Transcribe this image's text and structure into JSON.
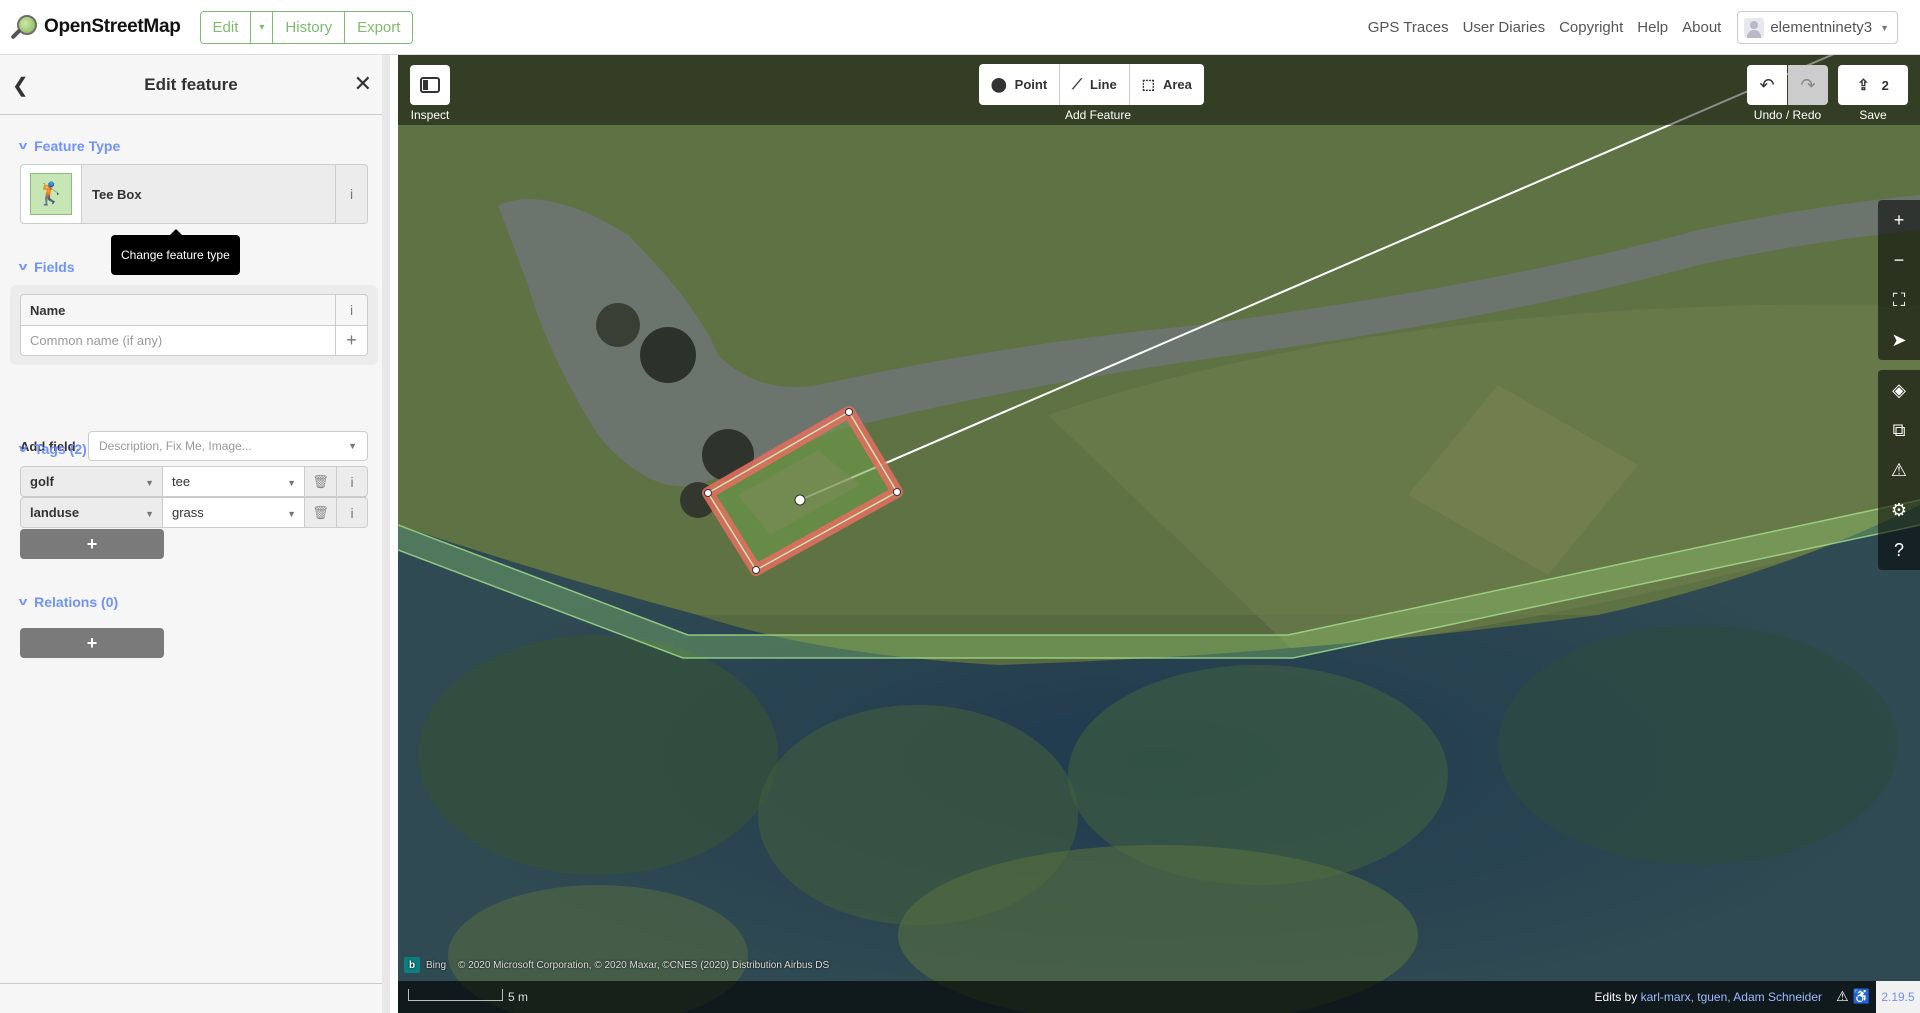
{
  "topnav": {
    "brand": "OpenStreetMap",
    "buttons": {
      "edit": "Edit",
      "caret": "▾",
      "history": "History",
      "export": "Export"
    },
    "links": [
      "GPS Traces",
      "User Diaries",
      "Copyright",
      "Help",
      "About"
    ],
    "user": "elementninety3",
    "accent_color": "#7ebc6f"
  },
  "sidebar": {
    "title": "Edit feature",
    "feature_type": {
      "section": "Feature Type",
      "name": "Tee Box",
      "icon": "golfer-icon"
    },
    "tooltip": "Change feature type",
    "fields": {
      "section": "Fields",
      "name_label": "Name",
      "name_placeholder": "Common name (if any)",
      "name_value": ""
    },
    "add_field": {
      "label": "Add field:",
      "placeholder": "Description, Fix Me, Image..."
    },
    "tags": {
      "section": "Tags (2)",
      "rows": [
        {
          "key": "golf",
          "value": "tee"
        },
        {
          "key": "landuse",
          "value": "grass"
        }
      ],
      "add": "+"
    },
    "relations": {
      "section": "Relations (0)",
      "add": "+"
    },
    "section_color": "#7092ff"
  },
  "toolbar": {
    "inspect": "Inspect",
    "add_feature": "Add Feature",
    "modes": [
      {
        "label": "Point",
        "icon": "marker-icon"
      },
      {
        "label": "Line",
        "icon": "line-icon"
      },
      {
        "label": "Area",
        "icon": "area-icon"
      }
    ],
    "undo_redo": "Undo / Redo",
    "save": "Save",
    "save_count": "2"
  },
  "map": {
    "attribution_source": "Bing",
    "attribution": "© 2020 Microsoft Corporation, © 2020 Maxar, ©CNES (2020) Distribution Airbus DS",
    "scale": "5 m",
    "edits_prefix": "Edits by",
    "editors": "karl-marx, tguen, Adam Schneider",
    "version": "2.19.5",
    "selected_color": "#e06e5f"
  }
}
